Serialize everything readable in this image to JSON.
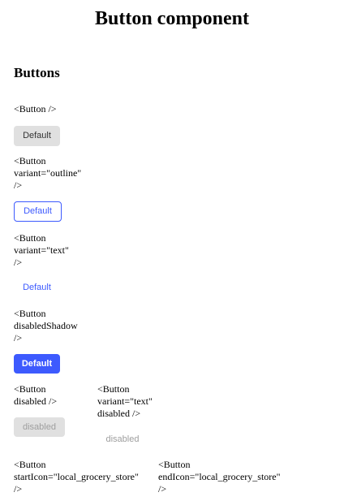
{
  "page": {
    "title": "Button component"
  },
  "section": {
    "title": "Buttons"
  },
  "examples": [
    {
      "code": "<Button />",
      "button_label": "Default"
    },
    {
      "code": "<Button\nvariant=\"outline\"\n/>",
      "button_label": "Default"
    },
    {
      "code": "<Button\nvariant=\"text\"\n/>",
      "button_label": "Default"
    },
    {
      "code": "<Button\ndisabledShadow\n/>",
      "button_label": "Default"
    },
    {
      "code": "<Button\ndisabled />",
      "button_label": "disabled"
    },
    {
      "code": "<Button\nvariant=\"text\"\ndisabled />",
      "button_label": "disabled"
    },
    {
      "code": "<Button\nstartIcon=\"local_grocery_store\"\n/>"
    },
    {
      "code": "<Button\nendIcon=\"local_grocery_store\"\n/>"
    }
  ],
  "colors": {
    "primary": "#3d5afe",
    "default_bg": "#e0e0e0",
    "disabled_text": "#9e9e9e"
  }
}
